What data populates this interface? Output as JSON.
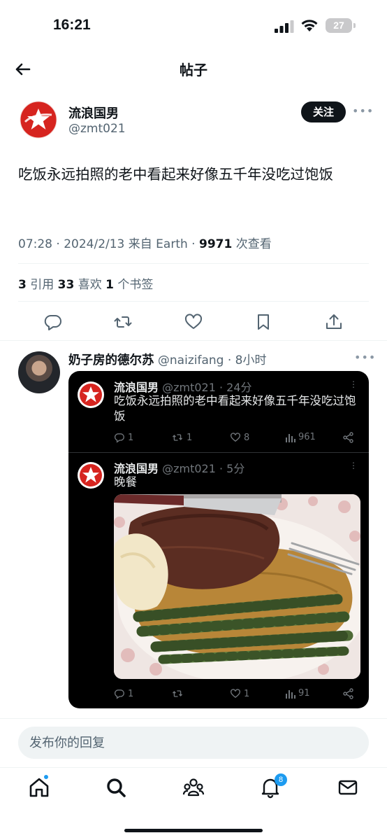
{
  "status_bar": {
    "time": "16:21",
    "battery": "27"
  },
  "header": {
    "title": "帖子"
  },
  "post": {
    "author_name": "流浪国男",
    "author_handle": "@zmt021",
    "follow_label": "关注",
    "text": "吃饭永远拍照的老中看起来好像五千年没吃过饱饭",
    "timestamp": "07:28 · 2024/2/13 来自 Earth · ",
    "views_count": "9971",
    "views_label": " 次查看",
    "stats": {
      "quotes_count": "3",
      "quotes_label": " 引用  ",
      "likes_count": "33",
      "likes_label": " 喜欢  ",
      "bookmarks_count": "1",
      "bookmarks_label": " 个书签"
    }
  },
  "reply": {
    "author_name": "奶子房的德尔苏",
    "author_handle": " @naizifang · 8小时",
    "quoted": [
      {
        "author_name": "流浪国男",
        "author_meta": " @zmt021 · 24分",
        "text": "吃饭永远拍照的老中看起来好像五千年没吃过饱饭",
        "replies": "1",
        "retweets": "1",
        "likes": "8",
        "views": "961"
      },
      {
        "author_name": "流浪国男",
        "author_meta": " @zmt021 · 5分",
        "text": "晚餐",
        "replies": "1",
        "retweets": "",
        "likes": "1",
        "views": "91"
      }
    ]
  },
  "reply_bar": {
    "placeholder": "发布你的回复"
  },
  "tab_bar": {
    "notifications_badge": "8"
  },
  "colors": {
    "accent": "#1d9bf0",
    "text": "#0f1419",
    "secondary": "#536471",
    "logo_red": "#d6241f"
  }
}
